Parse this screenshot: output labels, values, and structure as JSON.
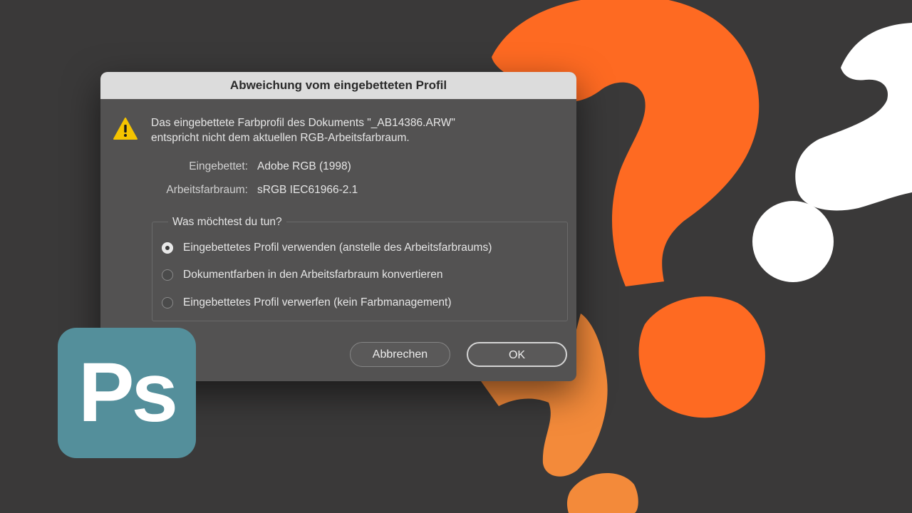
{
  "dialog": {
    "title": "Abweichung vom eingebetteten Profil",
    "icon": "warning-icon",
    "message_line1": "Das eingebettete Farbprofil des Dokuments \"_AB14386.ARW\"",
    "message_line2": "entspricht nicht dem aktuellen RGB-Arbeitsfarbraum.",
    "embedded_label": "Eingebettet:",
    "embedded_value": "Adobe RGB (1998)",
    "working_label": "Arbeitsfarbraum:",
    "working_value": "sRGB IEC61966-2.1",
    "group_title": "Was möchtest du tun?",
    "options": [
      {
        "label": "Eingebettetes Profil verwenden (anstelle des Arbeitsfarbraums)",
        "selected": true
      },
      {
        "label": "Dokumentfarben in den Arbeitsfarbraum konvertieren",
        "selected": false
      },
      {
        "label": "Eingebettetes Profil verwerfen (kein Farbmanagement)",
        "selected": false
      }
    ],
    "cancel_label": "Abbrechen",
    "ok_label": "OK"
  },
  "logo": {
    "text": "Ps",
    "color": "#548f9b"
  },
  "colors": {
    "background": "#3a3939",
    "orange": "#fe6a22",
    "light_orange": "#f38a3a",
    "white": "#ffffff"
  }
}
